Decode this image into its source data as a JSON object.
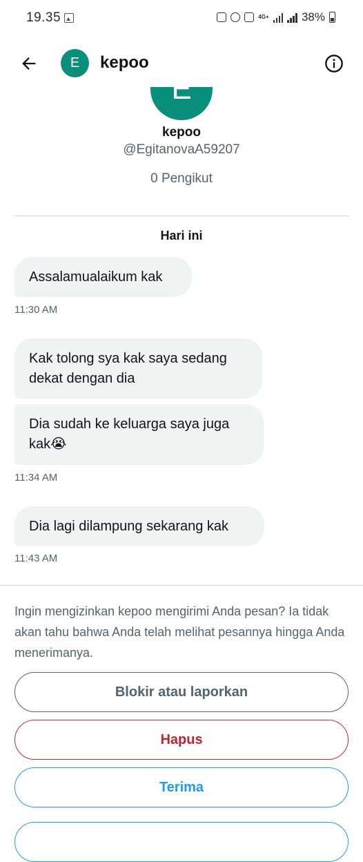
{
  "status_bar": {
    "time": "19.35",
    "network": "4G+",
    "battery": "38%"
  },
  "header": {
    "avatar_letter": "E",
    "name": "kepoo",
    "back_icon": "arrow-left-icon",
    "info_icon": "info-circle-icon"
  },
  "profile": {
    "avatar_letter": "E",
    "name": "kepoo",
    "handle": "@EgitanovaA59207",
    "followers": "0 Pengikut"
  },
  "conversation": {
    "date_label": "Hari ini",
    "groups": [
      {
        "messages": [
          "Assalamualaikum kak"
        ],
        "time": "11:30 AM"
      },
      {
        "messages": [
          "Kak tolong sya kak saya sedang dekat dengan dia",
          "Dia sudah ke keluarga saya juga kak😭"
        ],
        "time": "11:34 AM"
      },
      {
        "messages": [
          "Dia lagi dilampung sekarang kak"
        ],
        "time": "11:43 AM"
      }
    ]
  },
  "request": {
    "notice": "Ingin mengizinkan kepoo mengirimi Anda pesan? Ia tidak akan tahu bahwa Anda telah melihat pesannya hingga Anda menerimanya.",
    "block_label": "Blokir atau laporkan",
    "delete_label": "Hapus",
    "accept_label": "Terima"
  },
  "colors": {
    "avatar": "#0a8f7c",
    "accent": "#1d9bf0",
    "danger": "#c0222f",
    "bubble": "#eff3f4",
    "secondary_text": "#536471"
  }
}
